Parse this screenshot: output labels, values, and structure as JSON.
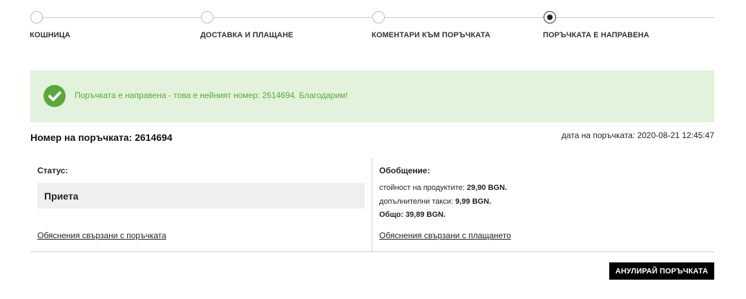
{
  "stepper": {
    "steps": [
      {
        "label": "КОШНИЦА",
        "active": false
      },
      {
        "label": "ДОСТАВКА И ПЛАЩАНЕ",
        "active": false
      },
      {
        "label": "КОМЕНТАРИ КЪМ ПОРЪЧКАТА",
        "active": false
      },
      {
        "label": "ПОРЪЧКАТА Е НАПРАВЕНА",
        "active": true
      }
    ]
  },
  "banner": {
    "message": "Поръчката е направена - това е нейният номер: 2614694. Благодарим!",
    "icon": "check-circle-icon",
    "color": "#5aa83c",
    "background": "#e2f2dc"
  },
  "order": {
    "title": "Номер на поръчката: 2614694",
    "date": "дата на поръчката: 2020-08-21 12:45:47"
  },
  "status_panel": {
    "heading": "Статус:",
    "value": "Приета",
    "link": "Обяснения свързани с поръчката"
  },
  "summary_panel": {
    "heading": "Обобщение:",
    "lines": [
      {
        "label": "стойност на продуктите:",
        "value": "29,90 BGN."
      },
      {
        "label": "допълнителни такси:",
        "value": "9,99 BGN."
      },
      {
        "label": "Общо:",
        "value": "39,89 BGN."
      }
    ],
    "link": "Обяснения свързани с плащането"
  },
  "actions": {
    "cancel_label": "АНУЛИРАЙ ПОРЪЧКАТА"
  }
}
